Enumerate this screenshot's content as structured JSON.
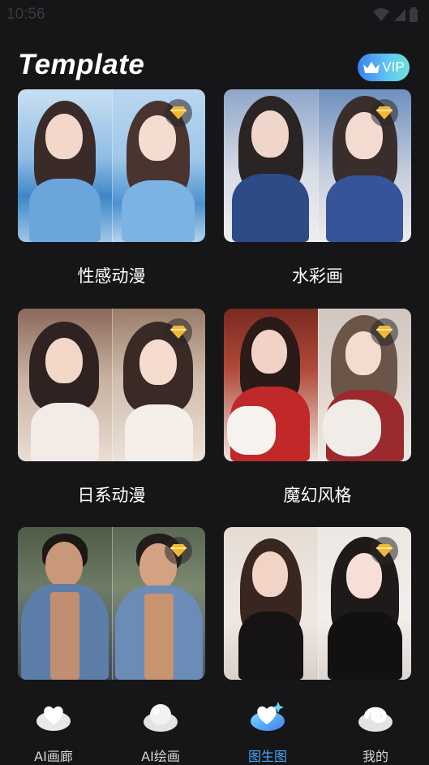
{
  "status_bar": {
    "time": "10:56"
  },
  "header": {
    "title": "Template",
    "vip_label": "VIP"
  },
  "colors": {
    "background": "#161618",
    "accent": "#4aa8ff",
    "vip_gradient_start": "#3a7ff0",
    "vip_gradient_end": "#6ee3d8",
    "premium_gem": "#f2b733"
  },
  "templates": [
    {
      "label": "性感动漫",
      "premium": true
    },
    {
      "label": "水彩画",
      "premium": true
    },
    {
      "label": "日系动漫",
      "premium": true
    },
    {
      "label": "魔幻风格",
      "premium": true
    },
    {
      "label": "",
      "premium": true
    },
    {
      "label": "",
      "premium": true
    }
  ],
  "nav": {
    "items": [
      {
        "label": "AI画廊",
        "icon": "heart-cloud-icon",
        "active": false
      },
      {
        "label": "AI绘画",
        "icon": "ball-cloud-icon",
        "active": false
      },
      {
        "label": "图生图",
        "icon": "heart-gradient-icon",
        "active": true
      },
      {
        "label": "我的",
        "icon": "swirl-cloud-icon",
        "active": false
      }
    ]
  }
}
